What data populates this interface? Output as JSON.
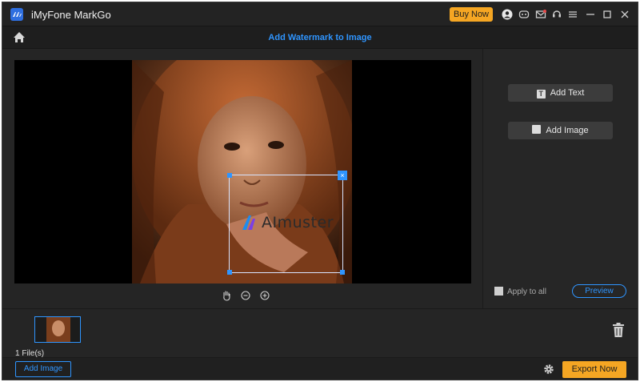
{
  "app": {
    "title": "iMyFone MarkGo",
    "buy_label": "Buy Now"
  },
  "header": {
    "title": "Add Watermark to Image"
  },
  "watermark": {
    "text": "AImuster",
    "close_glyph": "×"
  },
  "right_panel": {
    "add_text_label": "Add Text",
    "add_image_label": "Add Image",
    "apply_all_label": "Apply to all",
    "preview_label": "Preview"
  },
  "files": {
    "count_label": "1 File(s)"
  },
  "footer": {
    "add_image_label": "Add Image",
    "export_label": "Export Now"
  },
  "colors": {
    "accent": "#2f95ff",
    "buy": "#f5a623",
    "background": "#252525"
  },
  "icons": {
    "titlebar": [
      "user-icon",
      "discord-icon",
      "mail-icon",
      "support-icon",
      "menu-icon",
      "minimize-icon",
      "maximize-icon",
      "close-icon"
    ],
    "zoom": [
      "hand-icon",
      "zoom-out-icon",
      "zoom-in-icon"
    ]
  }
}
